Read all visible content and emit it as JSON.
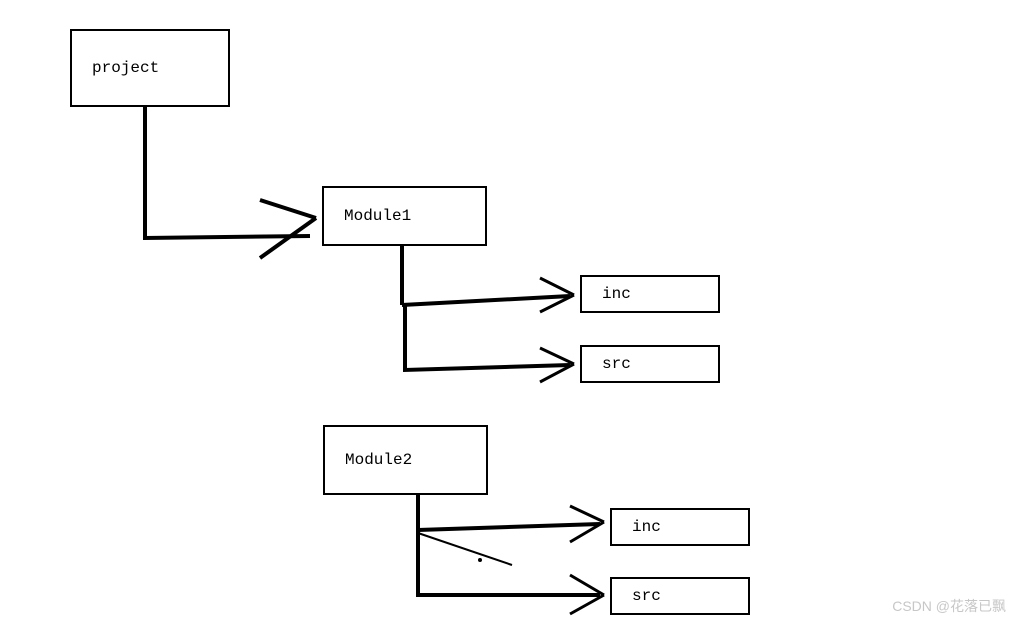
{
  "boxes": {
    "project": "project",
    "module1": "Module1",
    "inc1": "inc",
    "src1": "src",
    "module2": "Module2",
    "inc2": "inc",
    "src2": "src"
  },
  "watermark": "CSDN @花落已飘",
  "chart_data": {
    "type": "tree",
    "root": {
      "name": "project",
      "children": [
        {
          "name": "Module1",
          "children": [
            {
              "name": "inc"
            },
            {
              "name": "src"
            }
          ]
        },
        {
          "name": "Module2",
          "children": [
            {
              "name": "inc"
            },
            {
              "name": "src"
            }
          ]
        }
      ]
    }
  }
}
